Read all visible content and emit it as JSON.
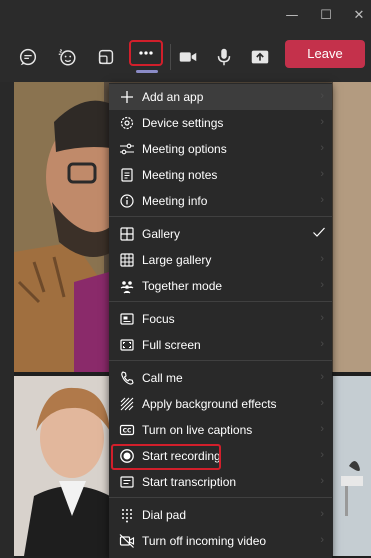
{
  "window": {
    "minimize_glyph": "—",
    "maximize_glyph": "☐",
    "close_glyph": "✕"
  },
  "toolbar": {
    "leave_label": "Leave",
    "icons": [
      "chat-icon",
      "reactions-icon",
      "share-tray-icon",
      "more-options-icon",
      "camera-icon",
      "microphone-icon",
      "share-screen-icon"
    ]
  },
  "menu": {
    "items": [
      {
        "label": "Add an app",
        "icon": "plus-icon"
      },
      {
        "label": "Device settings",
        "icon": "gear-icon"
      },
      {
        "label": "Meeting options",
        "icon": "sliders-icon"
      },
      {
        "label": "Meeting notes",
        "icon": "notes-icon"
      },
      {
        "label": "Meeting info",
        "icon": "info-icon"
      },
      {
        "label": "Gallery",
        "icon": "gallery-icon"
      },
      {
        "label": "Large gallery",
        "icon": "large-gallery-icon"
      },
      {
        "label": "Together mode",
        "icon": "together-mode-icon"
      },
      {
        "label": "Focus",
        "icon": "focus-icon"
      },
      {
        "label": "Full screen",
        "icon": "full-screen-icon"
      },
      {
        "label": "Call me",
        "icon": "phone-icon"
      },
      {
        "label": "Apply background effects",
        "icon": "background-effects-icon"
      },
      {
        "label": "Turn on live captions",
        "icon": "captions-icon"
      },
      {
        "label": "Start recording",
        "icon": "record-icon"
      },
      {
        "label": "Start transcription",
        "icon": "transcription-icon"
      },
      {
        "label": "Dial pad",
        "icon": "dial-pad-icon"
      },
      {
        "label": "Turn off incoming video",
        "icon": "video-off-icon"
      }
    ]
  },
  "colors": {
    "accent": "#8b8cc7",
    "leave": "#c4314b",
    "highlight": "#d21f2b"
  }
}
